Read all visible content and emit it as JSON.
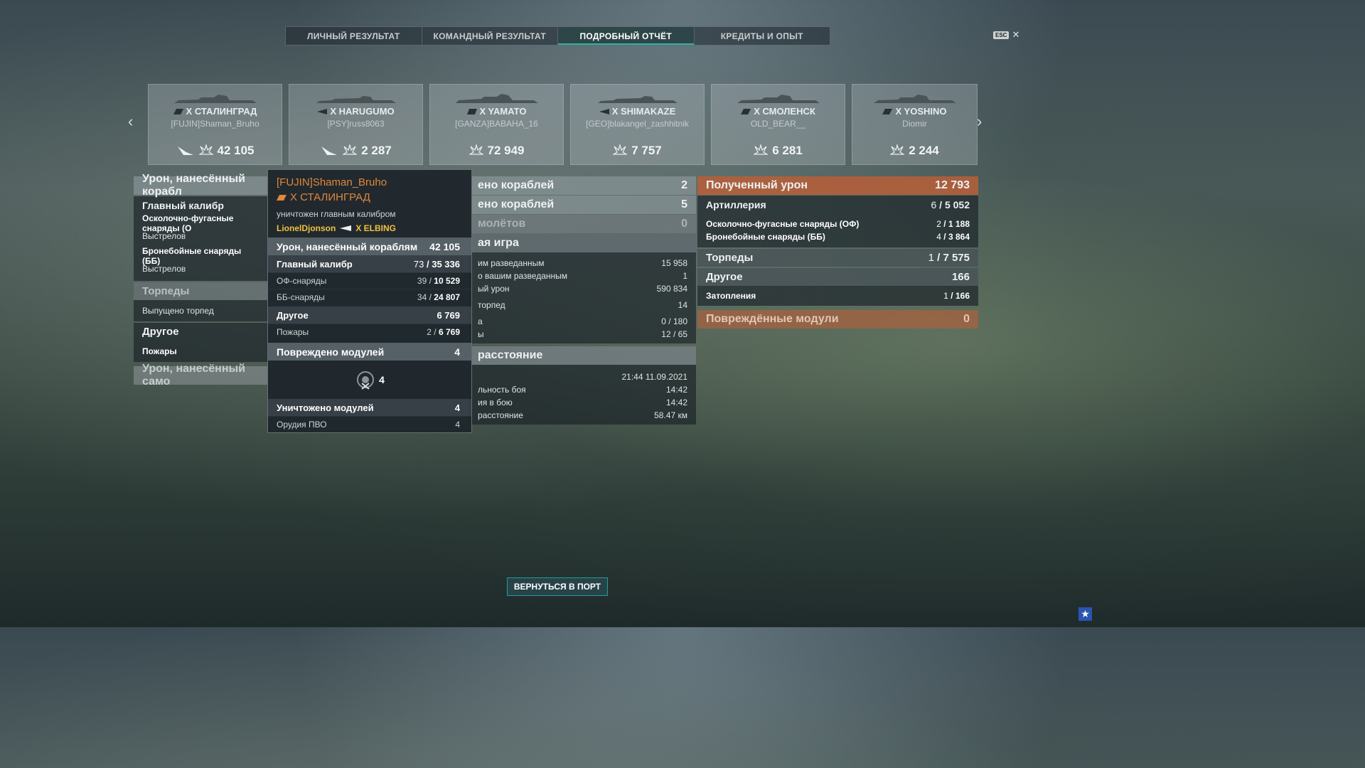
{
  "tabs": [
    {
      "label": "ЛИЧНЫЙ РЕЗУЛЬТАТ"
    },
    {
      "label": "КОМАНДНЫЙ РЕЗУЛЬТАТ"
    },
    {
      "label": "ПОДРОБНЫЙ ОТЧЁТ"
    },
    {
      "label": "КРЕДИТЫ И ОПЫТ"
    }
  ],
  "esc": {
    "key": "ESC",
    "close": "✕"
  },
  "nav": {
    "prev": "‹",
    "next": "›"
  },
  "ships": [
    {
      "name": "X СТАЛИНГРАД",
      "player": "[FUJIN]Shaman_Bruho",
      "damage": "42 105",
      "sunk_icon": true
    },
    {
      "name": "X HARUGUMO",
      "player": "[PSY]russ8063",
      "damage": "2 287",
      "sunk_icon": true
    },
    {
      "name": "X YAMATO",
      "player": "[GANZA]BABAHA_16",
      "damage": "72 949",
      "sunk_icon": false
    },
    {
      "name": "X SHIMAKAZE",
      "player": "[GEO]blakangel_zashhitnik",
      "damage": "7 757",
      "sunk_icon": false
    },
    {
      "name": "X СМОЛЕНСК",
      "player": "OLD_BEAR__",
      "damage": "6 281",
      "sunk_icon": false
    },
    {
      "name": "X YOSHINO",
      "player": "Diomir",
      "damage": "2 244",
      "sunk_icon": false
    }
  ],
  "left": {
    "header": "Урон, нанесённый корабл",
    "main_caliber": "Главный калибр",
    "he": "Осколочно-фугасные снаряды (О",
    "shots1": "Выстрелов",
    "ap": "Бронебойные снаряды (ББ)",
    "shots2": "Выстрелов",
    "torpedoes": "Торпеды",
    "torps_fired": "Выпущено торпед",
    "other": "Другое",
    "fires": "Пожары",
    "self_damage": "Урон, нанесённый само"
  },
  "mid": {
    "row1_label": "ено кораблей",
    "row1_val": "2",
    "row2_label": "ено кораблей",
    "row2_val": "5",
    "row3_label": "молётов",
    "row3_val": "0",
    "team_header": "ая игра",
    "r1_label": "им разведанным",
    "r1_val": "15 958",
    "r2_label": "о вашим разведанным",
    "r2_val": "1",
    "r3_label": "ый урон",
    "r3_val": "590 834",
    "r4_label": "торпед",
    "r4_val": "14",
    "r5_label": "а",
    "r5_val": "0 / 180",
    "r6_label": "ы",
    "r6_val": "12 / 65",
    "dist_header": "расстояние",
    "d1_val": "21:44  11.09.2021",
    "d2_label": "льность боя",
    "d2_val": "14:42",
    "d3_label": "ия в бою",
    "d3_val": "14:42",
    "d4_label": "расстояние",
    "d4_val": "58.47 км"
  },
  "right": {
    "received_label": "Полученный урон",
    "received_val": "12 793",
    "artillery_label": "Артиллерия",
    "artillery_hits": "6",
    "artillery_dmg": "5 052",
    "he_label": "Осколочно-фугасные снаряды (ОФ)",
    "he_hits": "2",
    "he_dmg": "1 188",
    "ap_label": "Бронебойные снаряды (ББ)",
    "ap_hits": "4",
    "ap_dmg": "3 864",
    "torp_label": "Торпеды",
    "torp_hits": "1",
    "torp_dmg": "7 575",
    "other_label": "Другое",
    "other_val": "166",
    "flood_label": "Затопления",
    "flood_hits": "1",
    "flood_dmg": "166",
    "modules_label": "Повреждённые модули",
    "modules_val": "0"
  },
  "tooltip": {
    "player": "[FUJIN]Shaman_Bruho",
    "ship": "X СТАЛИНГРАД",
    "kill_text": "уничтожен главным калибром",
    "killer": "LionelDjonson",
    "killer_ship": "X ELBING",
    "dmg_label": "Урон, нанесённый кораблям",
    "dmg_val": "42 105",
    "mc_label": "Главный калибр",
    "mc_hits": "73",
    "mc_dmg": "35 336",
    "he_label": "ОФ-снаряды",
    "he_hits": "39",
    "he_dmg": "10 529",
    "ap_label": "ББ-снаряды",
    "ap_hits": "34",
    "ap_dmg": "24 807",
    "other_label": "Другое",
    "other_val": "6 769",
    "fires_label": "Пожары",
    "fires_hits": "2",
    "fires_dmg": "6 769",
    "mod_dmg_label": "Повреждено модулей",
    "mod_dmg_val": "4",
    "mod_icon_count": "4",
    "mod_destroyed_label": "Уничтожено модулей",
    "mod_destroyed_val": "4",
    "aa_label": "Орудия ПВО",
    "aa_val": "4"
  },
  "back_button": "ВЕРНУТЬСЯ В ПОРТ",
  "colors": {
    "accent": "#2fb3a5",
    "orange": "#b95f37",
    "tooltip_orange": "#e0873a",
    "killer": "#f0c040"
  }
}
